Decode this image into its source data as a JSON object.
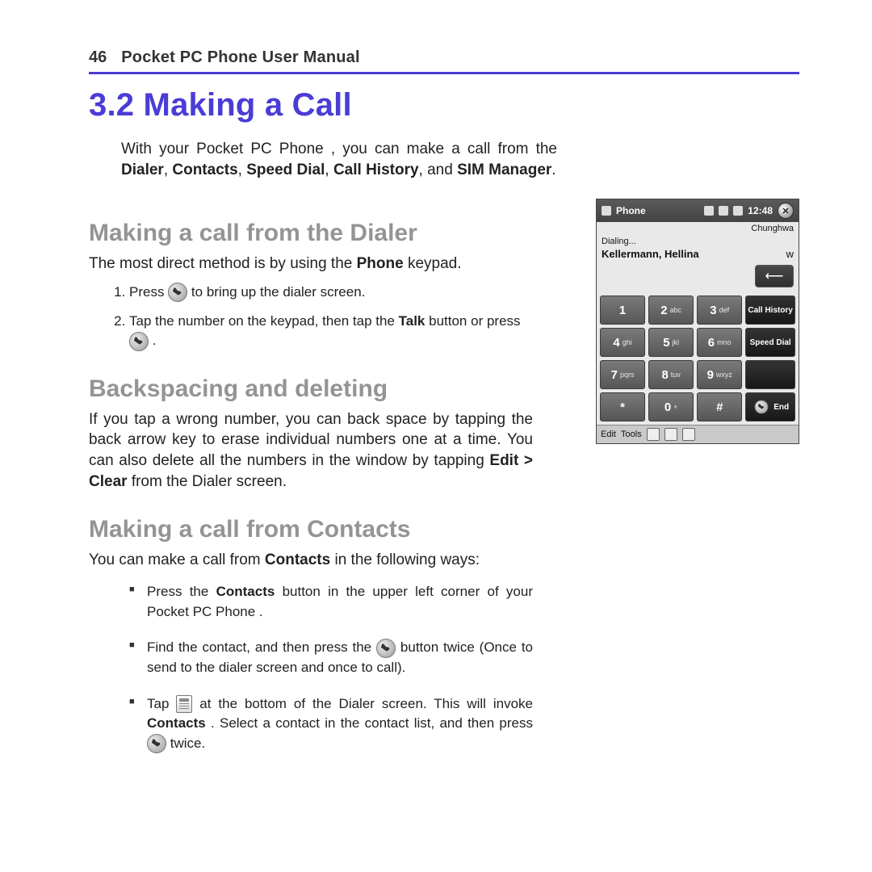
{
  "page": {
    "number": "46",
    "running_title": "Pocket PC Phone User Manual"
  },
  "section": {
    "number": "3.2",
    "title": "Making a Call"
  },
  "intro": {
    "pre": "With your Pocket PC Phone , you can make a call from the ",
    "bold1": "Dialer",
    "sep1": ", ",
    "bold2": "Contacts",
    "sep2": ", ",
    "bold3": "Speed Dial",
    "sep3": ", ",
    "bold4": "Call History",
    "sep4": ", and ",
    "bold5": "SIM Manager",
    "post": "."
  },
  "sub1": {
    "title": "Making a call from the Dialer",
    "para_pre": "The most direct method is by using the ",
    "para_bold": "Phone",
    "para_post": " keypad."
  },
  "steps": {
    "s1_pre": "Press ",
    "s1_post": " to bring up the dialer screen.",
    "s2_pre": "Tap the number on the keypad, then tap the ",
    "s2_bold": "Talk",
    "s2_mid": " button or press ",
    "s2_post": "."
  },
  "sub2": {
    "title": "Backspacing and deleting",
    "para_pre": "If you tap a wrong number, you can back space by tapping the back arrow key to erase individual numbers one at a time. You can also delete all the numbers in the window by tapping ",
    "para_bold": "Edit > Clear",
    "para_post": " from the Dialer screen."
  },
  "sub3": {
    "title": "Making a call from Contacts",
    "para_pre": "You can make a call from ",
    "para_bold": "Contacts",
    "para_post": " in the following ways:"
  },
  "bullets": {
    "b1_pre": "Press the ",
    "b1_bold": "Contacts",
    "b1_post": " button in the upper left corner of your Pocket PC Phone .",
    "b2_pre": "Find the contact, and then press the ",
    "b2_post": " button twice (Once to send to the dialer screen and once to call).",
    "b3_pre": "Tap ",
    "b3_mid": " at the bottom of the Dialer screen. This will invoke ",
    "b3_bold": "Contacts",
    "b3_post": ". Select a contact in the contact list, and then press ",
    "b3_tail": " twice."
  },
  "phone": {
    "title": "Phone",
    "clock": "12:48",
    "carrier": "Chunghwa",
    "status": "Dialing...",
    "contact": "Kellermann, Hellina",
    "letter": "w",
    "keys": [
      {
        "d": "1",
        "l": ""
      },
      {
        "d": "2",
        "l": "abc"
      },
      {
        "d": "3",
        "l": "def"
      },
      {
        "dark": true,
        "lbl": "Call History"
      },
      {
        "d": "4",
        "l": "ghi"
      },
      {
        "d": "5",
        "l": "jkl"
      },
      {
        "d": "6",
        "l": "mno"
      },
      {
        "dark": true,
        "lbl": "Speed Dial"
      },
      {
        "d": "7",
        "l": "pqrs"
      },
      {
        "d": "8",
        "l": "tuv"
      },
      {
        "d": "9",
        "l": "wxyz"
      },
      {
        "dark": true,
        "lbl": ""
      },
      {
        "d": "*",
        "l": ""
      },
      {
        "d": "0",
        "l": "+"
      },
      {
        "d": "#",
        "l": ""
      },
      {
        "dark": true,
        "lbl": "End",
        "icon": "phone"
      }
    ],
    "bottom": {
      "edit": "Edit",
      "tools": "Tools"
    }
  }
}
